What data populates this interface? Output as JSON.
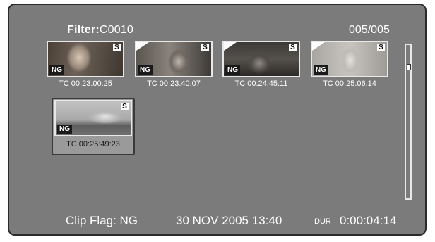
{
  "header": {
    "filter_label": "Filter:",
    "filter_value": "C0010",
    "page_count": "005/005"
  },
  "clips": [
    {
      "timecode": "TC 00:23:00:25",
      "s_badge": "S",
      "ng_badge": "NG"
    },
    {
      "timecode": "TC 00:23:40:07",
      "s_badge": "S",
      "ng_badge": "NG"
    },
    {
      "timecode": "TC 00:24:45:11",
      "s_badge": "S",
      "ng_badge": "NG"
    },
    {
      "timecode": "TC 00:25:06:14",
      "s_badge": "S",
      "ng_badge": "NG"
    },
    {
      "timecode": "TC 00:25:49:23",
      "s_badge": "S",
      "ng_badge": "NG",
      "selected": true
    }
  ],
  "footer": {
    "clip_flag": "Clip Flag: NG",
    "datetime": "30 NOV 2005 13:40",
    "dur_label": "DUR",
    "dur_value": "0:00:04:14"
  },
  "colors": {
    "screen_bg": "#7b7b7b",
    "text": "#ffffff",
    "selection_bg": "#9a9a9a"
  }
}
